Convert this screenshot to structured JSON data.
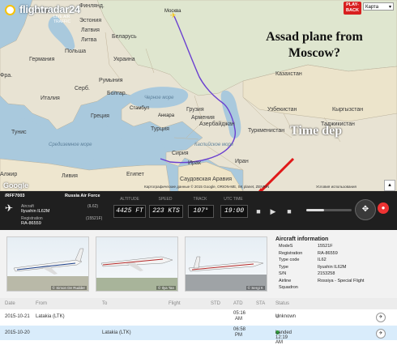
{
  "app": {
    "logo": "flightradar24",
    "logo_sub": "LIVE AIR TRAFFIC",
    "playback_label_1": "PLAY-",
    "playback_label_2": "BACK",
    "map_type": "Карта"
  },
  "map": {
    "labels": {
      "moscow": "Москва",
      "sweden": "Швеция",
      "finland": "Финлянд.",
      "estonia": "Эстония",
      "latvia": "Латвия",
      "lithuania": "Литва",
      "belarus": "Беларусь",
      "poland": "Польша",
      "germany": "Германия",
      "ukraine": "Украина",
      "romania": "Румыния",
      "italy": "Италия",
      "greece": "Греция",
      "turkey": "Турция",
      "georgia": "Грузия",
      "azerbaijan": "Азербайджан",
      "armenia": "Армения",
      "syria": "Сирия",
      "iraq": "Ирак",
      "iran": "Иран",
      "turkmenistan": "Туркменистан",
      "kazakhstan": "Казахстан",
      "uzbekistan": "Узбекистан",
      "kyrgyzstan": "Кыргызстан",
      "tajikistan": "Таджикистан",
      "libya": "Ливия",
      "egypt": "Египет",
      "tunisia": "Тунис",
      "algeria": "Алжир",
      "saudi": "Саудовская Аравия",
      "france": "Фра.",
      "bulgaria": "Болгар.",
      "serbia": "Серб.",
      "mediterranean": "Средиземное море",
      "caspian": "Каспийское море",
      "black_sea": "Черное море",
      "istanbul": "Стамбул",
      "ankara": "Анкара"
    },
    "annotation_1": "Assad plane from Moscow?",
    "annotation_2": "Time dep",
    "google": "Google",
    "credits": "Картографические данные © 2015 Google, ORION-ME, SK planet, ZENRIN",
    "terms": "Условия использования"
  },
  "flight": {
    "callsign": "/RFF7003",
    "operator": "Russia Air Force",
    "aircraft_label": "Aircraft",
    "aircraft_code": "(IL62)",
    "aircraft_name": "Ilyushin IL62M",
    "registration_label": "Registration",
    "registration_code": "(15521F)",
    "registration": "RA-86559",
    "altitude_label": "ALTITUDE",
    "altitude": "4425 FT",
    "speed_label": "SPEED",
    "speed": "223 KTS",
    "track_label": "TRACK",
    "track": "107°",
    "utc_label": "UTC TIME",
    "utc_time": "19:00"
  },
  "photos": [
    {
      "credit": "© Simon De Rudder"
    },
    {
      "credit": "© Ilya Tan"
    },
    {
      "credit": "© Sergi K"
    }
  ],
  "aircraft_info": {
    "title": "Aircraft information",
    "rows": [
      {
        "k": "ModeS",
        "v": "15521F"
      },
      {
        "k": "Registration",
        "v": "RA-86559"
      },
      {
        "k": "Type code",
        "v": "IL62"
      },
      {
        "k": "Type",
        "v": "Ilyushin IL62M"
      },
      {
        "k": "S/N",
        "v": "2153258"
      },
      {
        "k": "Airline",
        "v": "Rossiya - Special Flight"
      },
      {
        "k": "Squadron",
        "v": ""
      }
    ]
  },
  "table": {
    "headers": [
      "Date",
      "From",
      "To",
      "Flight",
      "STD",
      "ATD",
      "STA",
      "Status"
    ],
    "rows": [
      {
        "date": "2015-10-21",
        "from": "Latakia (LTK)",
        "to": "",
        "flight": "",
        "std": "",
        "atd_1": "05:16",
        "atd_2": "AM",
        "sta": "",
        "status": "Unknown",
        "status_color": "#c9c9c9"
      },
      {
        "date": "2015-10-20",
        "from": "",
        "to": "Latakia (LTK)",
        "flight": "",
        "std": "",
        "atd_1": "06:58",
        "atd_2": "PM",
        "sta": "",
        "status": "Landed 12:19 AM",
        "status_color": "#2e9e3a"
      }
    ]
  },
  "colors": {
    "route": "#6a3fd0",
    "arrow": "#e01818",
    "accent": "#d81f1f"
  }
}
